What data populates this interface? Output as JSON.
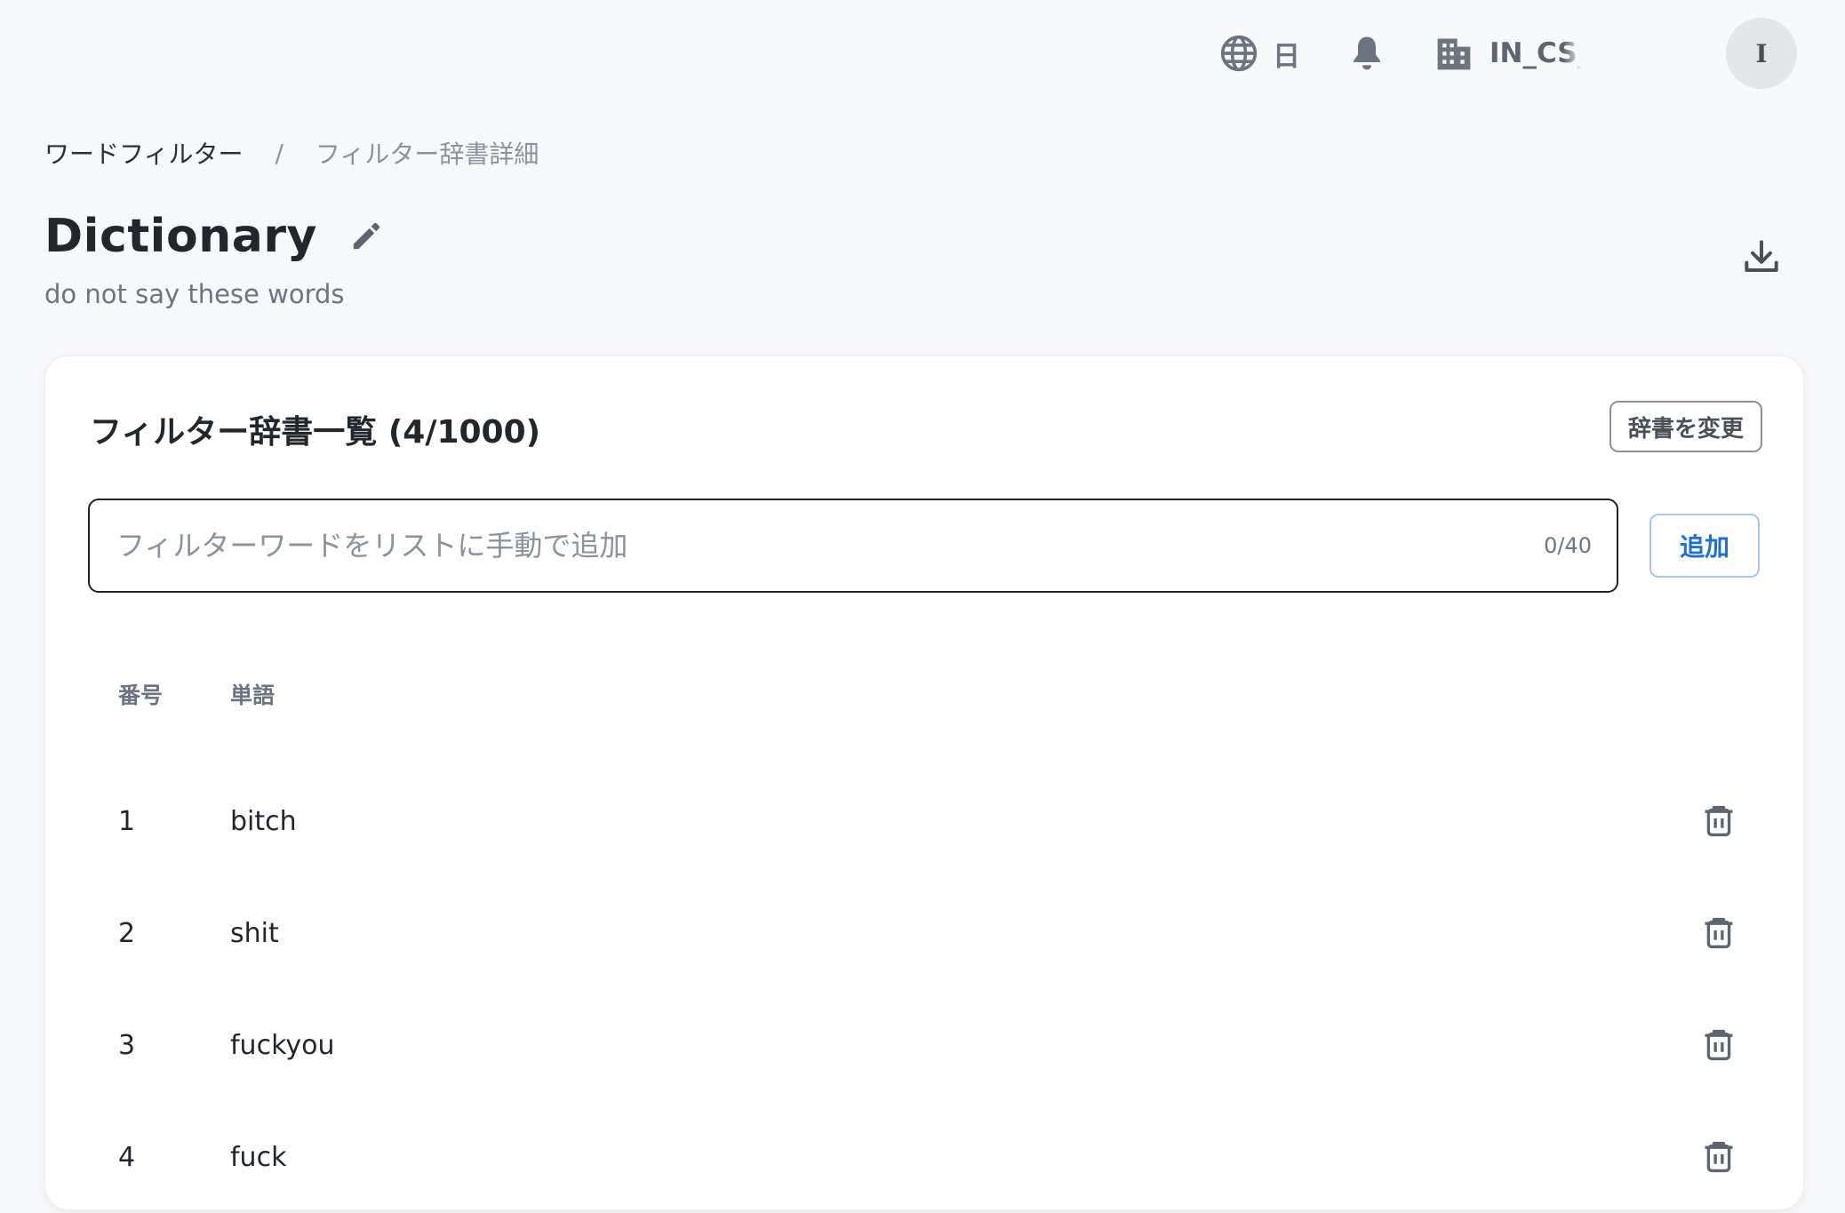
{
  "header": {
    "language_label": "日",
    "org_label": "IN_CS_",
    "avatar_initial": "I"
  },
  "breadcrumb": {
    "root": "ワードフィルター",
    "separator": "/",
    "current": "フィルター辞書詳細"
  },
  "page": {
    "title": "Dictionary",
    "subtitle": "do not say these words"
  },
  "card": {
    "title": "フィルター辞書一覧 (4/1000)",
    "change_button": "辞書を変更",
    "input": {
      "value": "",
      "placeholder": "フィルターワードをリストに手動で追加",
      "counter": "0/40"
    },
    "add_button": "追加",
    "table": {
      "headers": {
        "number": "番号",
        "word": "単語"
      },
      "rows": [
        {
          "number": "1",
          "word": "bitch"
        },
        {
          "number": "2",
          "word": "shit"
        },
        {
          "number": "3",
          "word": "fuckyou"
        },
        {
          "number": "4",
          "word": "fuck"
        }
      ]
    }
  },
  "icons": {
    "language": "globe-icon",
    "notifications": "bell-icon",
    "organization": "building-icon",
    "edit": "pencil-icon",
    "download": "download-icon",
    "delete": "trash-icon"
  },
  "colors": {
    "background": "#f7f8fa",
    "accent": "#1f6fd8",
    "muted": "#6b7480"
  }
}
